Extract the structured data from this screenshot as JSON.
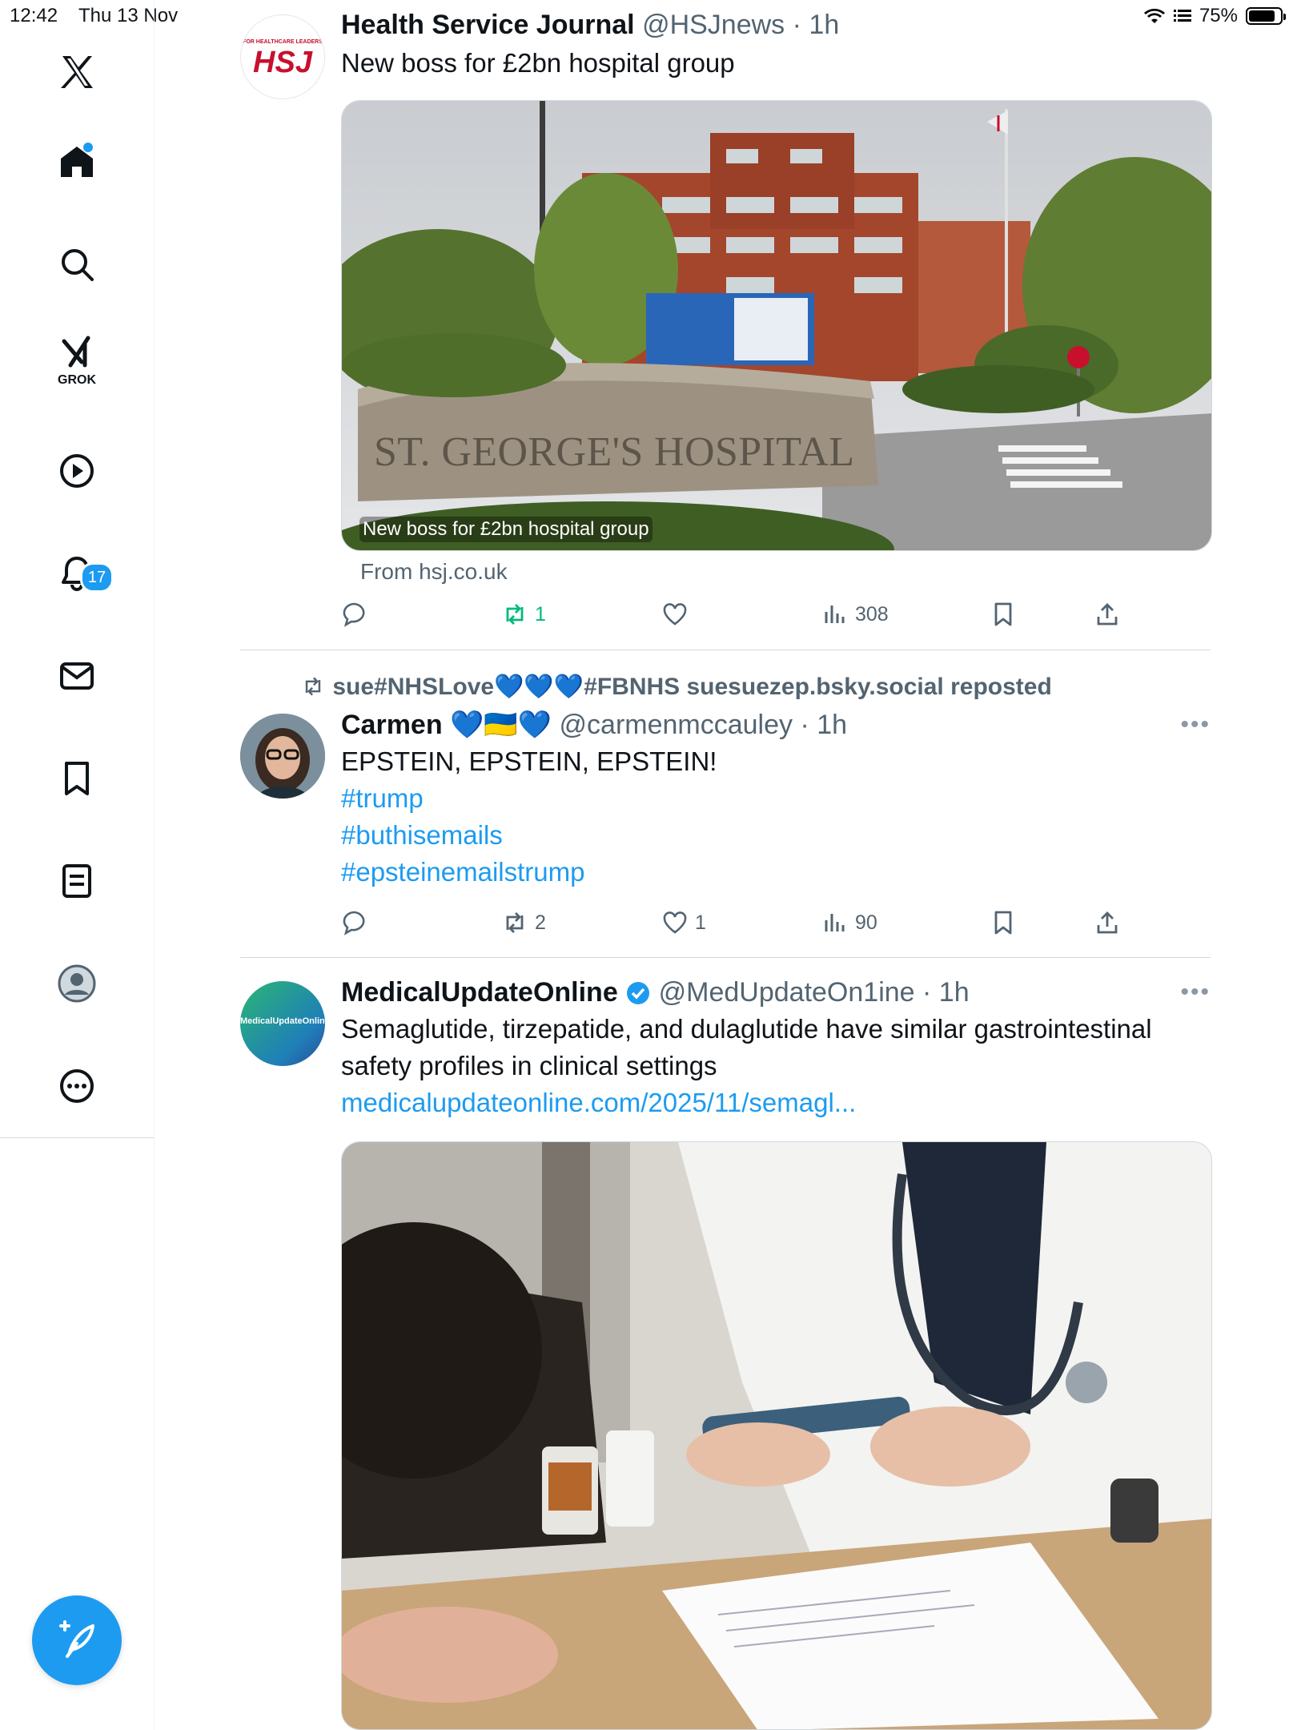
{
  "status_bar": {
    "time": "12:42",
    "date": "Thu 13 Nov",
    "battery": "75%"
  },
  "sidebar": {
    "grok_label": "GROK",
    "notifications_badge": "17",
    "items": [
      "x-logo-icon",
      "home-icon",
      "search-icon",
      "grok-icon",
      "video-icon",
      "notifications-icon",
      "messages-icon",
      "bookmarks-icon",
      "lists-icon",
      "profile-icon",
      "more-icon"
    ]
  },
  "posts": [
    {
      "name": "Health Service Journal",
      "handle": "@HSJnews",
      "time": "· 1h",
      "text": "New boss for £2bn hospital group",
      "avatar_text": "HSJ",
      "avatar_small": "FOR HEALTHCARE LEADERS",
      "card_caption": "New boss for £2bn hospital group",
      "card_source": "From hsj.co.uk",
      "sign_text": "ST. GEORGE'S HOSPITAL",
      "retweets": "1",
      "views": "308"
    },
    {
      "reposted_by": "sue#NHSLove💙💙💙#FBNHS suesuezep.bsky.social reposted",
      "name": "Carmen 💙🇺🇦💙",
      "handle": "@carmenmccauley",
      "time": "· 1h",
      "text": "EPSTEIN, EPSTEIN, EPSTEIN!",
      "hashtags": [
        "#trump",
        "#buthisemails",
        "#epsteinemailstrump"
      ],
      "retweets": "2",
      "likes": "1",
      "views": "90"
    },
    {
      "name": "MedicalUpdateOnline",
      "handle": "@MedUpdateOn1ine",
      "time": "· 1h",
      "text": "Semaglutide, tirzepatide, and dulaglutide have similar gastrointestinal safety profiles in clinical settings",
      "link": "medicalupdateonline.com/2025/11/semagl...",
      "avatar_text": "MedicalUpdateOnline"
    }
  ],
  "colors": {
    "accent": "#1d9bf0",
    "repost_green": "#00ba7c",
    "muted": "#536471"
  }
}
